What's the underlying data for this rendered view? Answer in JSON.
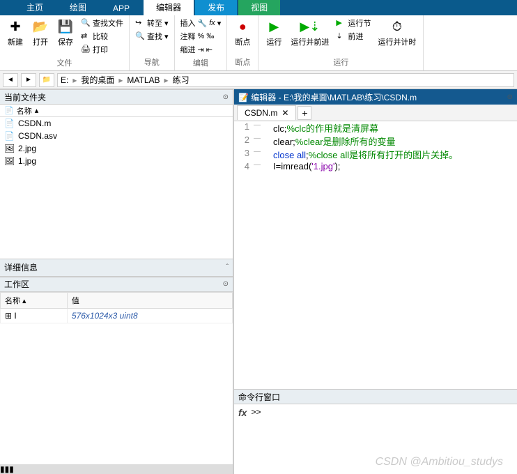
{
  "tabs": [
    "主页",
    "绘图",
    "APP",
    "编辑器",
    "发布",
    "视图"
  ],
  "ribbon": {
    "file": {
      "title": "文件",
      "new": "新建",
      "open": "打开",
      "save": "保存",
      "findFiles": "查找文件",
      "compare": "比较",
      "print": "打印"
    },
    "nav": {
      "title": "导航",
      "goto": "转至",
      "find": "查找"
    },
    "edit": {
      "title": "编辑",
      "insert": "插入",
      "comment": "注释",
      "indent": "缩进",
      "fx": "fx"
    },
    "break": {
      "title": "断点",
      "label": "断点"
    },
    "run": {
      "title": "运行",
      "run": "运行",
      "runAdvance": "运行并前进",
      "runSection": "运行节",
      "advance": "前进",
      "runTime": "运行并计时"
    }
  },
  "breadcrumb": [
    "E:",
    "我的桌面",
    "MATLAB",
    "练习"
  ],
  "panels": {
    "currentFolder": "当前文件夹",
    "nameCol": "名称",
    "details": "详细信息",
    "workspace": "工作区",
    "wsName": "名称",
    "wsValue": "值",
    "editorTitle": "编辑器 - E:\\我的桌面\\MATLAB\\练习\\CSDN.m",
    "cmdWindow": "命令行窗口",
    "prompt": ">>"
  },
  "files": [
    "CSDN.m",
    "CSDN.asv",
    "2.jpg",
    "1.jpg"
  ],
  "editorTab": "CSDN.m",
  "codeLines": [
    {
      "n": "1",
      "pre": "clc;",
      "cm": "%clc的作用就是清屏幕"
    },
    {
      "n": "2",
      "pre": "clear;",
      "cm": "%clear是删除所有的变量"
    },
    {
      "n": "3",
      "kw": "close ",
      "kw2": "all",
      "post": ";",
      "cm": "%close all是将所有打开的图片关掉。"
    },
    {
      "n": "4",
      "pre": "I=imread(",
      "str": "'1.jpg'",
      "post": ");"
    }
  ],
  "ws": [
    {
      "name": "I",
      "value": "576x1024x3 uint8"
    }
  ],
  "watermark": "CSDN @Ambitiou_studys"
}
